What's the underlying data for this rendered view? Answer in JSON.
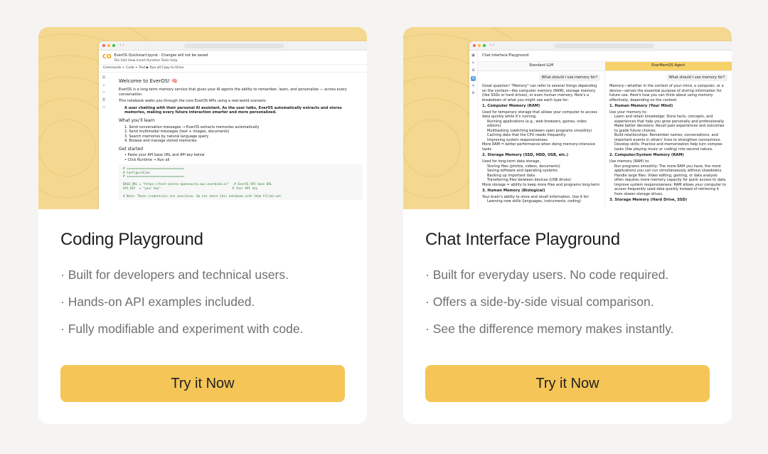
{
  "cards": [
    {
      "title": "Coding Playground",
      "features": [
        "· Built for developers and technical users.",
        "· Hands-on API examples included.",
        "· Fully modifiable and experiment with code."
      ],
      "cta_label": "Try it Now",
      "preview": {
        "file_name": "EverOS Quickstart.ipynb",
        "save_note": "Changes will not be saved",
        "menu": [
          "File",
          "Edit",
          "View",
          "Insert",
          "Runtime",
          "Tools",
          "Help"
        ],
        "toolbar": "Commands  + Code  + Text  ▶ Run all  Copy to Drive",
        "heading": "Welcome to EverOS! 🧠",
        "intro": "EverOS is a long-term memory service that gives your AI agents the ability to remember, learn, and personalize — across every conversation.",
        "walkthrough": "This notebook walks you through the core EverOS APIs using a real-world scenario:",
        "scenario": "A user chatting with their personal AI assistant. As the user talks, EverOS automatically extracts and stores memories, making every future interaction smarter and more personalized.",
        "learn_heading": "What you'll learn",
        "learn_items": [
          "1. Send conversation messages → EverOS extracts memories automatically",
          "2. Send multimodal messages (text + images, documents)",
          "3. Search memories by natural language query",
          "4. Browse and manage stored memories"
        ],
        "start_heading": "Get started",
        "start_items": [
          "• Paste your API base URL and API key below",
          "• Click Runtime → Run all"
        ],
        "code": "# ================================\n# Configuration\n# ================================\n\nBASE_URL = \"https://test-everos-opensource.aws.evermind.ai\"   # EverOS API base URL\nAPI_KEY  = \"your key\"                                        # Your API key\n\n# Note: These credentials are sensitive. Do not share this notebook with them filled out."
      }
    },
    {
      "title": "Chat Interface Playground",
      "features": [
        "· Built for everyday users. No code required.",
        "· Offers a side-by-side visual comparison.",
        "· See the difference memory makes instantly."
      ],
      "cta_label": "Try it Now",
      "preview": {
        "page_title": "Chat Interface Playground",
        "tab_standard": "Standard LLM",
        "tab_memory": "EverMemOS Agent",
        "question": "What should I use memory for?",
        "left_intro": "Great question! \"Memory\" can refer to several things depending on the context—like computer memory (RAM), storage memory (like SSDs or hard drives), or even human memory. Here's a breakdown of what you might use each type for:",
        "left_h1": "1. Computer Memory (RAM)",
        "left_h1_sub": "Used for temporary storage that allows your computer to access data quickly while it's running.",
        "left_list1": [
          "Running applications (e.g., web browsers, games, video editors)",
          "Multitasking (switching between open programs smoothly)",
          "Caching data that the CPU needs frequently",
          "Improving system responsiveness"
        ],
        "left_note1": "More RAM = better performance when doing memory-intensive tasks",
        "left_h2": "2. Storage Memory (SSD, HDD, USB, etc.)",
        "left_h2_sub": "Used for long-term data storage.",
        "left_list2": [
          "Storing files (photos, videos, documents)",
          "Saving software and operating systems",
          "Backing up important data",
          "Transferring files between devices (USB drives)"
        ],
        "left_note2": "More storage = ability to keep more files and programs long-term",
        "left_h3": "3. Human Memory (Biological)",
        "left_h3_sub": "Your brain's ability to store and recall information. Use it for:",
        "left_list3": [
          "Learning new skills (languages, instruments, coding)"
        ],
        "right_intro": "Memory—whether in the context of your mind, a computer, or a device—serves the essential purpose of storing information for future use. Here's how you can think about using memory effectively, depending on the context:",
        "right_h1": "1. Human Memory (Your Mind)",
        "right_h1_sub": "Use your memory to:",
        "right_list1": [
          "Learn and retain knowledge: Store facts, concepts, and experiences that help you grow personally and professionally.",
          "Make better decisions: Recall past experiences and outcomes to guide future choices.",
          "Build relationships: Remember names, conversations, and important events in others' lives to strengthen connections.",
          "Develop skills: Practice and memorization help turn complex tasks (like playing music or coding) into second nature."
        ],
        "right_h2": "2. Computer/System Memory (RAM)",
        "right_h2_sub": "Use memory (RAM) to:",
        "right_list2": [
          "Run programs smoothly: The more RAM you have, the more applications you can run simultaneously without slowdowns.",
          "Handle large files: Video editing, gaming, or data analysis often requires more memory capacity for quick access to data.",
          "Improve system responsiveness: RAM allows your computer to access frequently used data quickly instead of retrieving it from slower storage drives."
        ],
        "right_h3": "3. Storage Memory (Hard Drive, SSD)"
      }
    }
  ]
}
